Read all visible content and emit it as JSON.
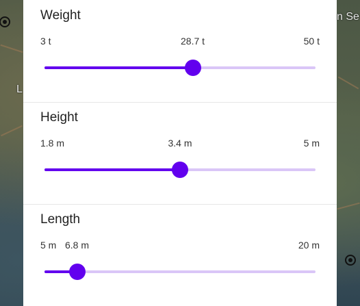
{
  "map": {
    "labels": [
      "n Se",
      "L"
    ],
    "colors": {
      "land": "#55604a",
      "water": "#2f4552",
      "roads": "#a07a55"
    }
  },
  "filters": [
    {
      "id": "weight",
      "title": "Weight",
      "min_label": "3 t",
      "value_label": "28.7 t",
      "max_label": "50 t",
      "min": 3,
      "max": 50,
      "value": 28.7
    },
    {
      "id": "height",
      "title": "Height",
      "min_label": "1.8 m",
      "value_label": "3.4 m",
      "max_label": "5 m",
      "min": 1.8,
      "max": 5,
      "value": 3.4
    },
    {
      "id": "length",
      "title": "Length",
      "min_label": "5 m",
      "value_label": "6.8 m",
      "max_label": "20 m",
      "min": 5,
      "max": 20,
      "value": 6.8
    }
  ],
  "colors": {
    "accent": "#6200ee",
    "track_inactive": "#dac6f7",
    "panel": "#ffffff"
  }
}
